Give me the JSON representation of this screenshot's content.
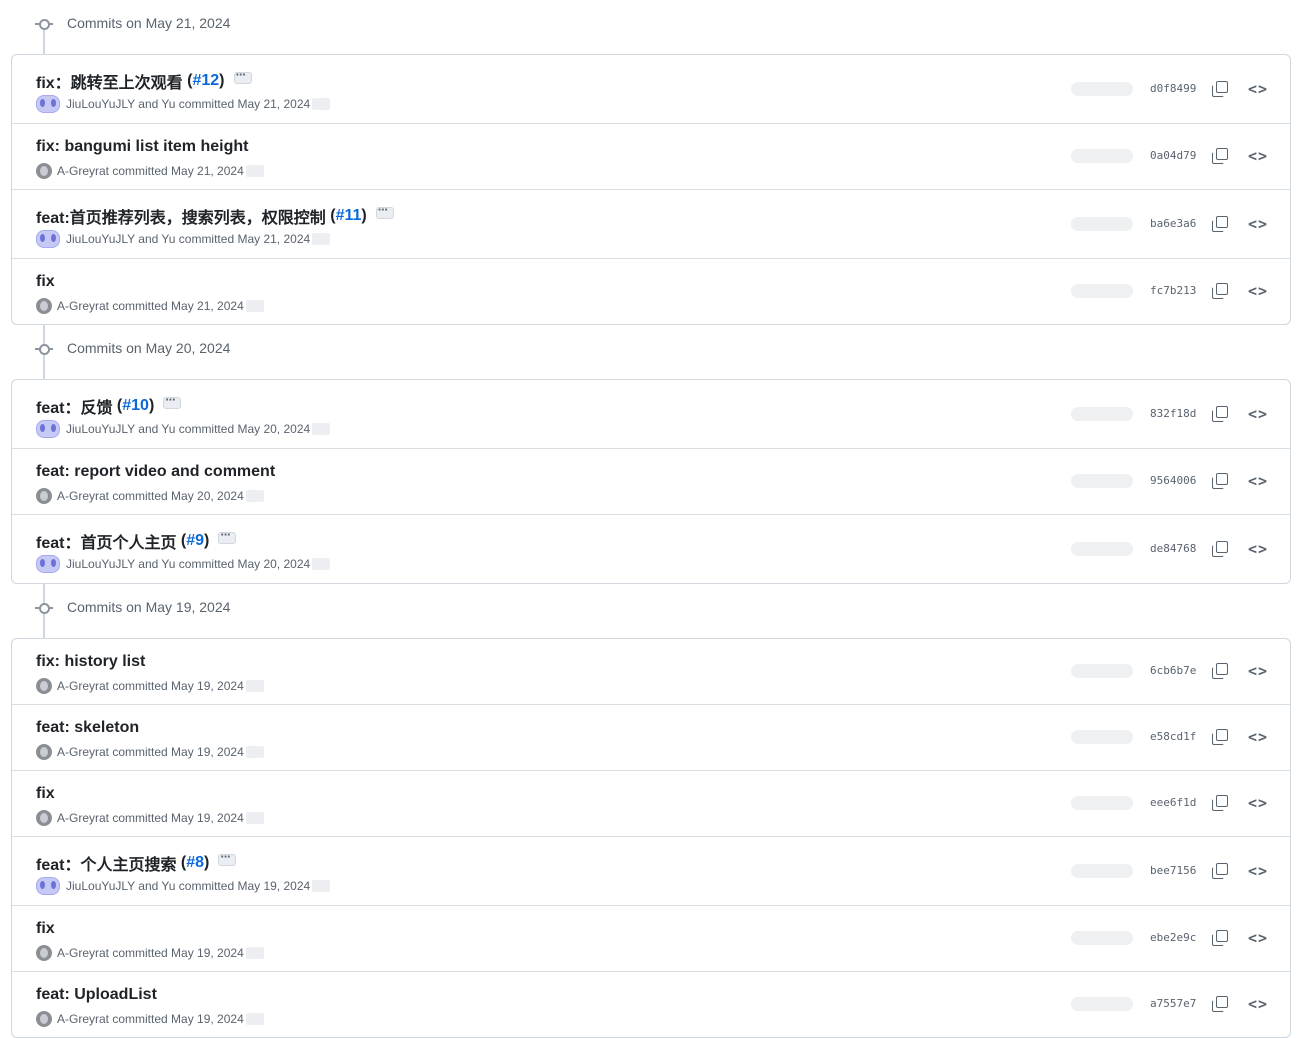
{
  "groups": [
    {
      "date_label": "Commits on May 21, 2024",
      "commits": [
        {
          "msg": "fix：跳转至上次观看",
          "pr": "#12",
          "author": "JiuLouYuJLY and Yu committed May 21, 2024",
          "pair": true,
          "sha": "d0f8499",
          "tall": true
        },
        {
          "msg": "fix: bangumi list item height",
          "pr": "",
          "author": "A-Greyrat committed May 21, 2024",
          "pair": false,
          "sha": "0a04d79",
          "tall": false
        },
        {
          "msg": "feat:首页推荐列表，搜索列表，权限控制",
          "pr": "#11",
          "author": "JiuLouYuJLY and Yu committed May 21, 2024",
          "pair": true,
          "sha": "ba6e3a6",
          "tall": true
        },
        {
          "msg": "fix",
          "pr": "",
          "author": "A-Greyrat committed May 21, 2024",
          "pair": false,
          "sha": "fc7b213",
          "tall": false
        }
      ]
    },
    {
      "date_label": "Commits on May 20, 2024",
      "commits": [
        {
          "msg": "feat：反馈",
          "pr": "#10",
          "author": "JiuLouYuJLY and Yu committed May 20, 2024",
          "pair": true,
          "sha": "832f18d",
          "tall": true
        },
        {
          "msg": "feat: report video and comment",
          "pr": "",
          "author": "A-Greyrat committed May 20, 2024",
          "pair": false,
          "sha": "9564006",
          "tall": false
        },
        {
          "msg": "feat：首页个人主页",
          "pr": "#9",
          "author": "JiuLouYuJLY and Yu committed May 20, 2024",
          "pair": true,
          "sha": "de84768",
          "tall": true
        }
      ]
    },
    {
      "date_label": "Commits on May 19, 2024",
      "commits": [
        {
          "msg": "fix: history list",
          "pr": "",
          "author": "A-Greyrat committed May 19, 2024",
          "pair": false,
          "sha": "6cb6b7e",
          "tall": false
        },
        {
          "msg": "feat: skeleton",
          "pr": "",
          "author": "A-Greyrat committed May 19, 2024",
          "pair": false,
          "sha": "e58cd1f",
          "tall": false
        },
        {
          "msg": "fix",
          "pr": "",
          "author": "A-Greyrat committed May 19, 2024",
          "pair": false,
          "sha": "eee6f1d",
          "tall": false
        },
        {
          "msg": "feat：个人主页搜索",
          "pr": "#8",
          "author": "JiuLouYuJLY and Yu committed May 19, 2024",
          "pair": true,
          "sha": "bee7156",
          "tall": true
        },
        {
          "msg": "fix",
          "pr": "",
          "author": "A-Greyrat committed May 19, 2024",
          "pair": false,
          "sha": "ebe2e9c",
          "tall": false
        },
        {
          "msg": "feat: UploadList",
          "pr": "",
          "author": "A-Greyrat committed May 19, 2024",
          "pair": false,
          "sha": "a7557e7",
          "tall": false
        }
      ]
    }
  ],
  "icons": {
    "commit_node": "git-commit-icon",
    "copy": "copy-icon",
    "browse": "code-icon",
    "expand": "ellipsis-icon"
  },
  "colors": {
    "link": "#0969da",
    "muted": "#59636e",
    "border": "#d0d7de"
  }
}
